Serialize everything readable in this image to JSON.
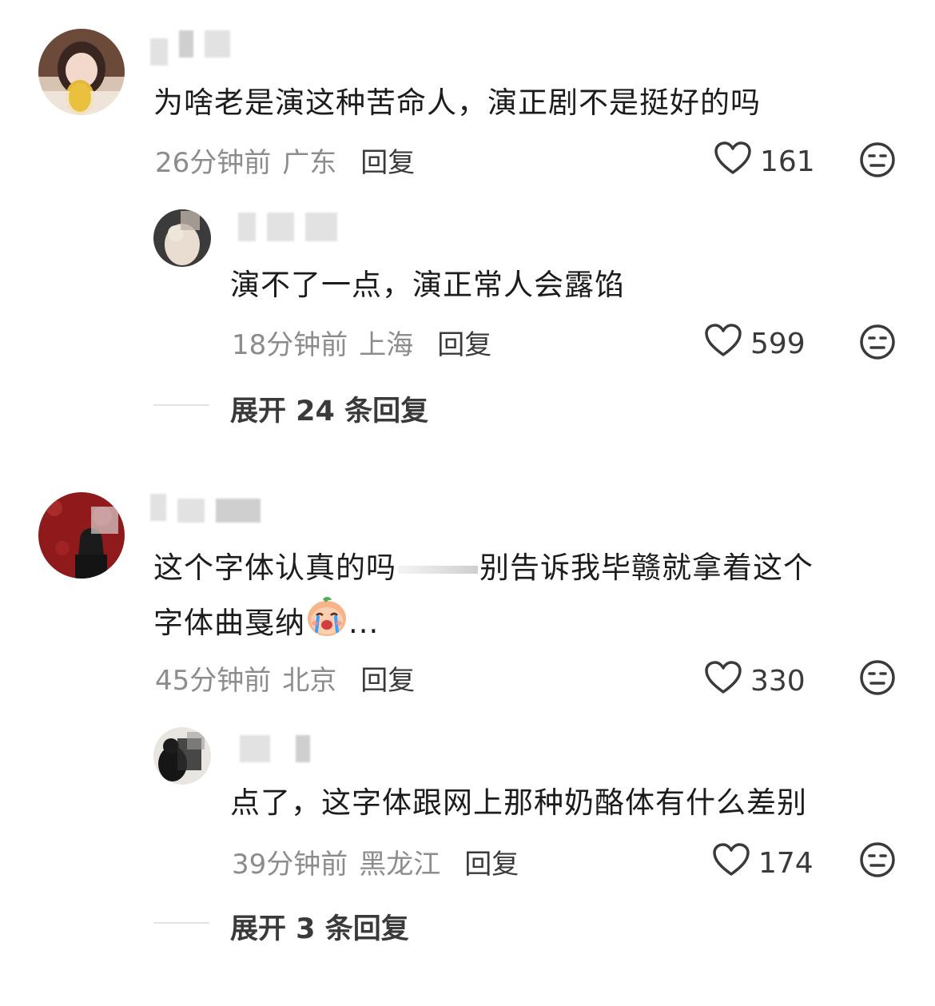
{
  "comments": [
    {
      "text": "为啥老是演这种苦命人，演正剧不是挺好的吗",
      "time": "26分钟前",
      "location": "广东",
      "reply_label": "回复",
      "likes": "161",
      "replies": [
        {
          "text": "演不了一点，演正常人会露馅",
          "time": "18分钟前",
          "location": "上海",
          "reply_label": "回复",
          "likes": "599"
        }
      ],
      "expand_label": "展开 24 条回复"
    },
    {
      "text_part1": "这个字体认真的吗",
      "text_part2": "别告诉我毕赣就拿着这个",
      "text_line2": "字体曲戛纳",
      "text_ellipsis": "...",
      "time": "45分钟前",
      "location": "北京",
      "reply_label": "回复",
      "likes": "330",
      "replies": [
        {
          "text": "点了，这字体跟网上那种奶酪体有什么差别",
          "time": "39分钟前",
          "location": "黑龙江",
          "reply_label": "回复",
          "likes": "174"
        }
      ],
      "expand_label": "展开 3 条回复"
    }
  ],
  "icons": {
    "like": "heart-outline-icon",
    "reaction": "meh-face-icon",
    "emoji": "crying-face-emoji"
  },
  "colors": {
    "text": "#1c1c1c",
    "meta": "#8c8c8c",
    "action": "#3a3a3a"
  }
}
